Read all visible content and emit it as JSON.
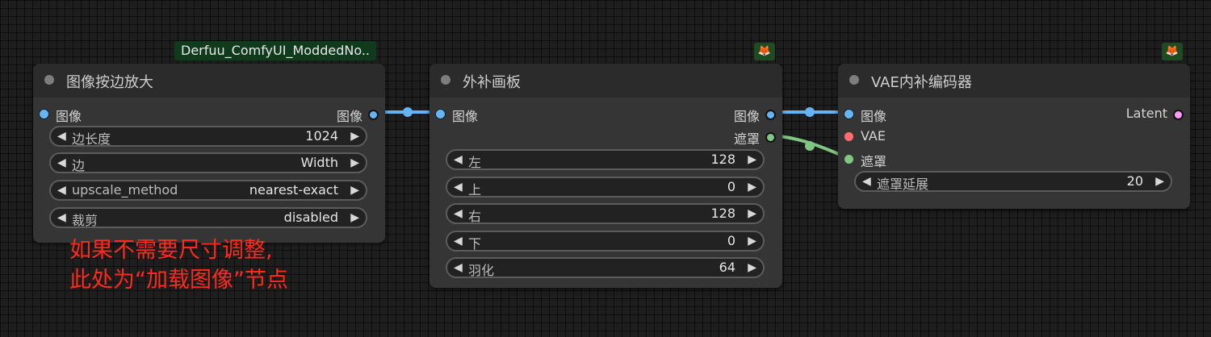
{
  "badges": {
    "derfuu": "Derfuu_ComfyUI_ModdedNo.."
  },
  "icons": {
    "fox_1": "fox-icon",
    "fox_2": "fox-icon"
  },
  "node1": {
    "title": "图像按边放大",
    "input_image": "图像",
    "output_image": "图像",
    "widgets": [
      {
        "label": "边长度",
        "value": "1024"
      },
      {
        "label": "边",
        "value": "Width"
      },
      {
        "label": "upscale_method",
        "value": "nearest-exact"
      },
      {
        "label": "裁剪",
        "value": "disabled"
      }
    ]
  },
  "node2": {
    "title": "外补画板",
    "input_image": "图像",
    "output_image": "图像",
    "output_mask": "遮罩",
    "widgets": [
      {
        "label": "左",
        "value": "128"
      },
      {
        "label": "上",
        "value": "0"
      },
      {
        "label": "右",
        "value": "128"
      },
      {
        "label": "下",
        "value": "0"
      },
      {
        "label": "羽化",
        "value": "64"
      }
    ]
  },
  "node3": {
    "title": "VAE内补编码器",
    "input_image": "图像",
    "input_vae": "VAE",
    "input_mask": "遮罩",
    "output_latent": "Latent",
    "widgets": [
      {
        "label": "遮罩延展",
        "value": "20"
      }
    ]
  },
  "annotation": {
    "line1": "如果不需要尺寸调整,",
    "line2": "此处为“加载图像”节点"
  },
  "colors": {
    "image_link": "#64b5f6",
    "mask_link": "#81c784",
    "vae": "#ff6e6e",
    "latent": "#ff9cf9",
    "annotation": "#ff2a1c",
    "badge_bg": "#0f3a1b"
  }
}
